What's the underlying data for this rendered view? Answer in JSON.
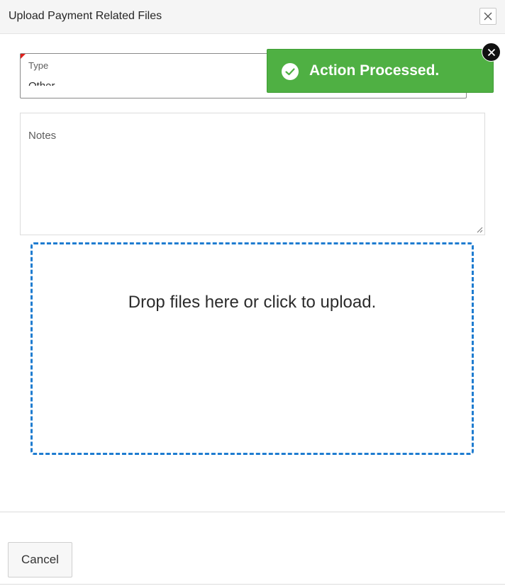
{
  "dialog": {
    "title": "Upload Payment Related Files",
    "close_icon": "close-icon"
  },
  "form": {
    "type_label": "Type",
    "type_value": "Other",
    "notes_label": "Notes",
    "dropzone_text": "Drop files here or click to upload."
  },
  "toast": {
    "message": "Action Processed.",
    "icon": "check-circle-icon",
    "close_icon": "close-icon",
    "color": "#4fb043"
  },
  "footer": {
    "cancel_label": "Cancel"
  },
  "colors": {
    "accent_dashed": "#1f7cd0",
    "required_flag": "#e0201b"
  }
}
